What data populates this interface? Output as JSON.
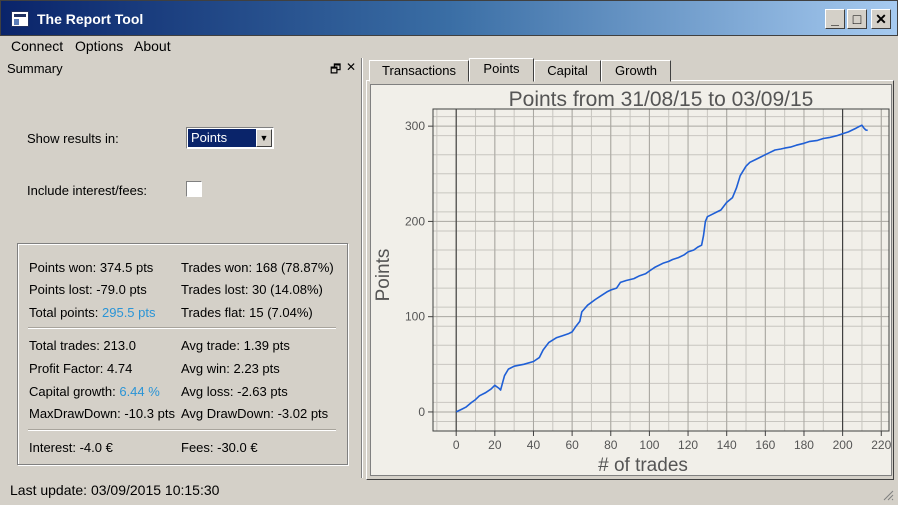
{
  "window": {
    "title": "The Report Tool",
    "buttons": [
      "_",
      "□",
      "✕"
    ]
  },
  "menu": [
    "Connect",
    "Options",
    "About"
  ],
  "summary": {
    "title": "Summary",
    "controls": {
      "float": "🗗",
      "close": "✕"
    },
    "show_results_label": "Show results in:",
    "show_results_value": "Points",
    "interest_label": "Include interest/fees:",
    "interest_checked": false
  },
  "stats": {
    "points_won": "Points won: 374.5 pts",
    "trades_won": "Trades won: 168 (78.87%)",
    "points_lost": "Points lost: -79.0 pts",
    "trades_lost": "Trades lost: 30 (14.08%)",
    "total_points_label": "Total points:",
    "total_points_value": "295.5 pts",
    "trades_flat": "Trades flat: 15 (7.04%)",
    "total_trades": "Total trades: 213.0",
    "avg_trade": "Avg trade: 1.39 pts",
    "profit_factor": "Profit Factor: 4.74",
    "avg_win": "Avg win: 2.23 pts",
    "capital_growth_label": "Capital growth:",
    "capital_growth_value": "6.44 %",
    "avg_loss": "Avg loss: -2.63 pts",
    "max_drawdown": "MaxDrawDown: -10.3 pts",
    "avg_drawdown": "Avg DrawDown: -3.02 pts",
    "interest": "Interest: -4.0 €",
    "fees": "Fees: -30.0 €"
  },
  "status": "Last update: 03/09/2015 10:15:30",
  "tabs": [
    "Transactions",
    "Points",
    "Capital",
    "Growth"
  ],
  "active_tab": "Points",
  "colors": {
    "line": "#1f5fd6",
    "highlight": "#2a94d6",
    "title_bar": "#0a246a"
  },
  "chart_data": {
    "type": "line",
    "title": "Points from 31/08/15 to 03/09/15",
    "xlabel": "# of trades",
    "ylabel": "Points",
    "xlim": [
      -12,
      224
    ],
    "ylim": [
      -20,
      318
    ],
    "xticks": [
      0,
      20,
      40,
      60,
      80,
      100,
      120,
      140,
      160,
      180,
      200,
      220
    ],
    "xtick_labels": [
      "0",
      "20",
      "40",
      "60",
      "80",
      "100",
      "120",
      "140",
      "160",
      "180",
      "200",
      "220"
    ],
    "yticks": [
      0,
      100,
      200,
      300
    ],
    "ytick_labels": [
      "0",
      "100",
      "200",
      "300"
    ],
    "grid": true,
    "series": [
      {
        "x": [
          0,
          3,
          5,
          8,
          10,
          12,
          15,
          18,
          20,
          22,
          23,
          25,
          27,
          30,
          35,
          40,
          43,
          45,
          48,
          52,
          55,
          58,
          60,
          62,
          64,
          65,
          68,
          72,
          75,
          78,
          80,
          83,
          85,
          88,
          92,
          95,
          98,
          100,
          103,
          107,
          110,
          112,
          115,
          118,
          120,
          123,
          125,
          127,
          128,
          129,
          130,
          133,
          135,
          137,
          140,
          143,
          145,
          147,
          150,
          152,
          155,
          158,
          160,
          162,
          165,
          168,
          170,
          173,
          176,
          180,
          183,
          187,
          190,
          193,
          197,
          200,
          203,
          205,
          207,
          209,
          210,
          211,
          212,
          213
        ],
        "y": [
          0,
          3,
          5,
          10,
          13,
          17,
          20,
          24,
          28,
          25,
          23,
          38,
          45,
          48,
          50,
          53,
          57,
          65,
          73,
          78,
          80,
          82,
          84,
          90,
          95,
          105,
          112,
          118,
          122,
          126,
          128,
          130,
          136,
          138,
          140,
          143,
          145,
          148,
          152,
          156,
          158,
          160,
          162,
          165,
          168,
          170,
          173,
          175,
          185,
          200,
          205,
          208,
          210,
          212,
          220,
          225,
          235,
          248,
          258,
          262,
          265,
          268,
          270,
          272,
          275,
          276,
          277,
          278,
          280,
          282,
          284,
          285,
          287,
          288,
          290,
          292,
          294,
          296,
          298,
          300,
          301,
          298,
          296,
          295.5
        ]
      }
    ]
  }
}
